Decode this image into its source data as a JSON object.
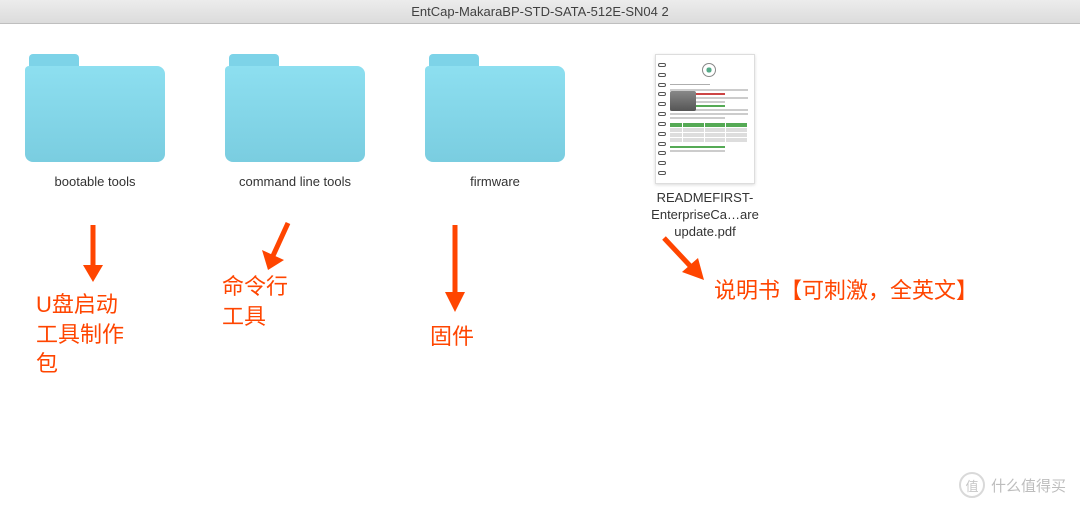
{
  "window": {
    "title": "EntCap-MakaraBP-STD-SATA-512E-SN04 2"
  },
  "items": [
    {
      "type": "folder",
      "label": "bootable tools"
    },
    {
      "type": "folder",
      "label": "command line tools"
    },
    {
      "type": "folder",
      "label": "firmware"
    },
    {
      "type": "pdf",
      "label": "READMEFIRST-EnterpriseCa…are update.pdf"
    }
  ],
  "annotations": [
    {
      "text": "U盘启动\n工具制作\n包"
    },
    {
      "text": "命令行\n工具"
    },
    {
      "text": "固件"
    },
    {
      "text": "说明书【可刺激，全英文】"
    }
  ],
  "watermark": {
    "badge": "值",
    "text": "什么值得买"
  }
}
